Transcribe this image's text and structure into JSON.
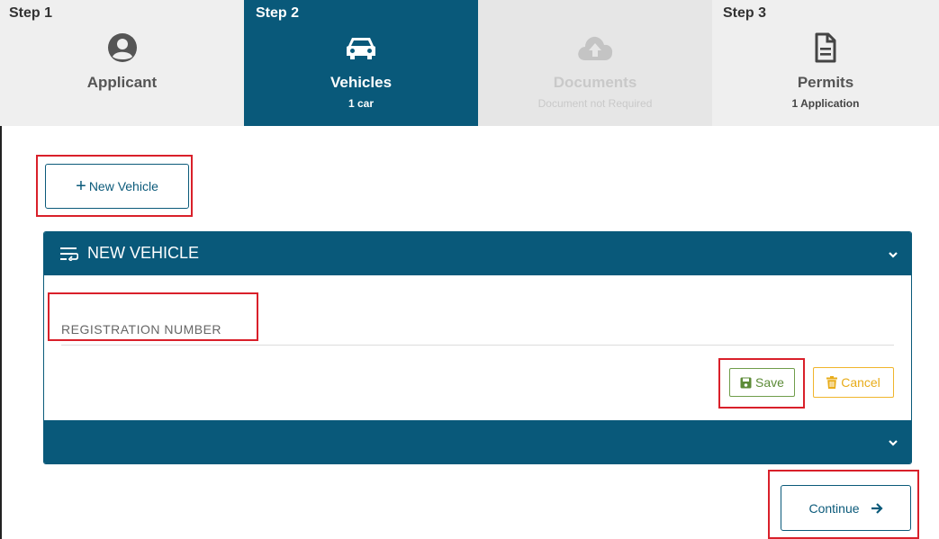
{
  "steps": [
    {
      "number": "Step 1",
      "title": "Applicant",
      "subtitle": "",
      "icon": "user-circle-icon"
    },
    {
      "number": "Step 2",
      "title": "Vehicles",
      "subtitle": "1 car",
      "icon": "car-icon"
    },
    {
      "number": "",
      "title": "Documents",
      "subtitle": "Document not Required",
      "icon": "cloud-upload-icon"
    },
    {
      "number": "Step 3",
      "title": "Permits",
      "subtitle": "1 Application",
      "icon": "document-icon"
    }
  ],
  "actions": {
    "new_vehicle_label": "New Vehicle",
    "continue_label": "Continue"
  },
  "vehicle_panel": {
    "title": "NEW VEHICLE",
    "registration_label": "REGISTRATION NUMBER",
    "registration_value": "",
    "save_label": "Save",
    "cancel_label": "Cancel"
  },
  "colors": {
    "primary": "#09597a",
    "save": "#5c8b37",
    "cancel": "#e8ac1a",
    "highlight": "#d9202a"
  }
}
